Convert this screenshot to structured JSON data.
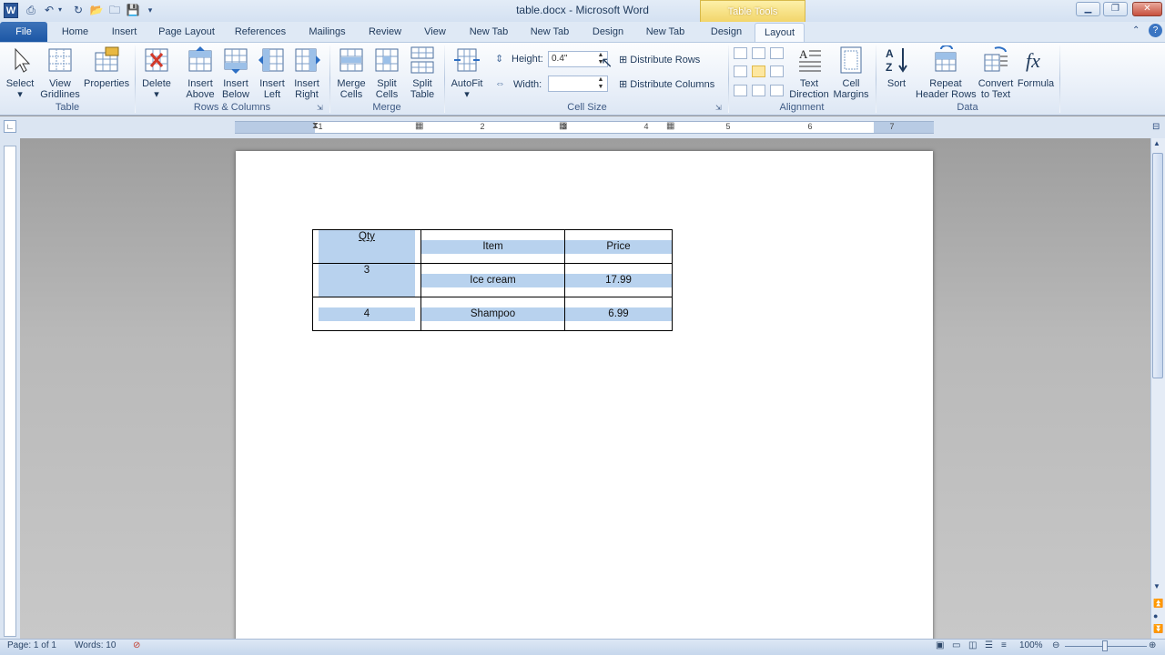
{
  "window": {
    "title": "table.docx - Microsoft Word",
    "context_tab": "Table Tools"
  },
  "tabs": [
    "File",
    "Home",
    "Insert",
    "Page Layout",
    "References",
    "Mailings",
    "Review",
    "View",
    "New Tab",
    "New Tab",
    "Design",
    "New Tab",
    "Design",
    "Layout"
  ],
  "ribbon": {
    "groups": {
      "table": "Table",
      "rows_columns": "Rows & Columns",
      "merge": "Merge",
      "cell_size": "Cell Size",
      "alignment": "Alignment",
      "data": "Data"
    },
    "buttons": {
      "select": "Select",
      "view_gridlines_1": "View",
      "view_gridlines_2": "Gridlines",
      "properties": "Properties",
      "delete": "Delete",
      "insert_above_1": "Insert",
      "insert_above_2": "Above",
      "insert_below_1": "Insert",
      "insert_below_2": "Below",
      "insert_left_1": "Insert",
      "insert_left_2": "Left",
      "insert_right_1": "Insert",
      "insert_right_2": "Right",
      "merge_cells_1": "Merge",
      "merge_cells_2": "Cells",
      "split_cells_1": "Split",
      "split_cells_2": "Cells",
      "split_table_1": "Split",
      "split_table_2": "Table",
      "autofit": "AutoFit",
      "height_label": "Height:",
      "height_value": "0.4\"",
      "width_label": "Width:",
      "width_value": "",
      "distribute_rows": "Distribute Rows",
      "distribute_columns": "Distribute Columns",
      "text_direction_1": "Text",
      "text_direction_2": "Direction",
      "cell_margins_1": "Cell",
      "cell_margins_2": "Margins",
      "sort": "Sort",
      "repeat_header_1": "Repeat",
      "repeat_header_2": "Header Rows",
      "convert_1": "Convert",
      "convert_2": "to Text",
      "formula": "Formula"
    }
  },
  "ruler": {
    "numbers": [
      "1",
      "2",
      "3",
      "4",
      "5",
      "6",
      "7"
    ]
  },
  "document": {
    "table": {
      "headers": [
        "Qty",
        "Item",
        "Price"
      ],
      "rows": [
        [
          "3",
          "Ice cream",
          "17.99"
        ],
        [
          "4",
          "Shampoo",
          "6.99"
        ]
      ]
    }
  },
  "status": {
    "page": "Page: 1 of 1",
    "words": "Words: 10",
    "zoom": "100%"
  },
  "colors": {
    "accent": "#2b579a",
    "context_tab": "#f2d56a",
    "highlight": "#b8d2ee"
  }
}
